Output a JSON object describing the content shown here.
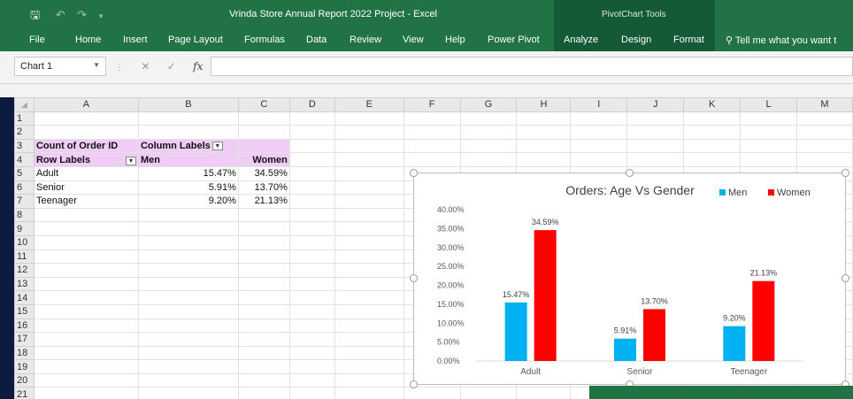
{
  "window": {
    "title": "Vrinda Store Annual Report 2022 Project  -  Excel",
    "contextual_tools": "PivotChart Tools"
  },
  "ribbon": {
    "tabs": [
      "File",
      "Home",
      "Insert",
      "Page Layout",
      "Formulas",
      "Data",
      "Review",
      "View",
      "Help",
      "Power Pivot",
      "Analyze",
      "Design",
      "Format"
    ],
    "tell_me": "Tell me what you want t"
  },
  "formula_bar": {
    "name_box": "Chart 1",
    "fx_label": "fx",
    "content": ""
  },
  "sheet": {
    "columns": [
      "A",
      "B",
      "C",
      "D",
      "E",
      "F",
      "G",
      "H",
      "I",
      "J",
      "K",
      "L",
      "M"
    ],
    "rows": [
      "1",
      "2",
      "3",
      "4",
      "5",
      "6",
      "7",
      "8",
      "9",
      "10",
      "11",
      "12",
      "13",
      "14",
      "15",
      "16",
      "17",
      "18",
      "19",
      "20",
      "21"
    ],
    "pivot": {
      "a3": "Count of Order ID",
      "b3": "Column Labels",
      "a4": "Row Labels",
      "b4": "Men",
      "c4": "Women",
      "data_rows": [
        {
          "label": "Adult",
          "men": "15.47%",
          "women": "34.59%"
        },
        {
          "label": "Senior",
          "men": "5.91%",
          "women": "13.70%"
        },
        {
          "label": "Teenager",
          "men": "9.20%",
          "women": "21.13%"
        }
      ]
    }
  },
  "chart_data": {
    "type": "bar",
    "title": "Orders: Age Vs Gender",
    "categories": [
      "Adult",
      "Senior",
      "Teenager"
    ],
    "series": [
      {
        "name": "Men",
        "values": [
          15.47,
          5.91,
          9.2
        ],
        "labels": [
          "15.47%",
          "5.91%",
          "9.20%"
        ],
        "color": "#00b0f0"
      },
      {
        "name": "Women",
        "values": [
          34.59,
          13.7,
          21.13
        ],
        "labels": [
          "34.59%",
          "13.70%",
          "21.13%"
        ],
        "color": "#ff0000"
      }
    ],
    "ylim": [
      0,
      40
    ],
    "yticks": [
      "0.00%",
      "5.00%",
      "10.00%",
      "15.00%",
      "20.00%",
      "25.00%",
      "30.00%",
      "35.00%",
      "40.00%"
    ],
    "legend_position": "top-right",
    "grid": false
  }
}
